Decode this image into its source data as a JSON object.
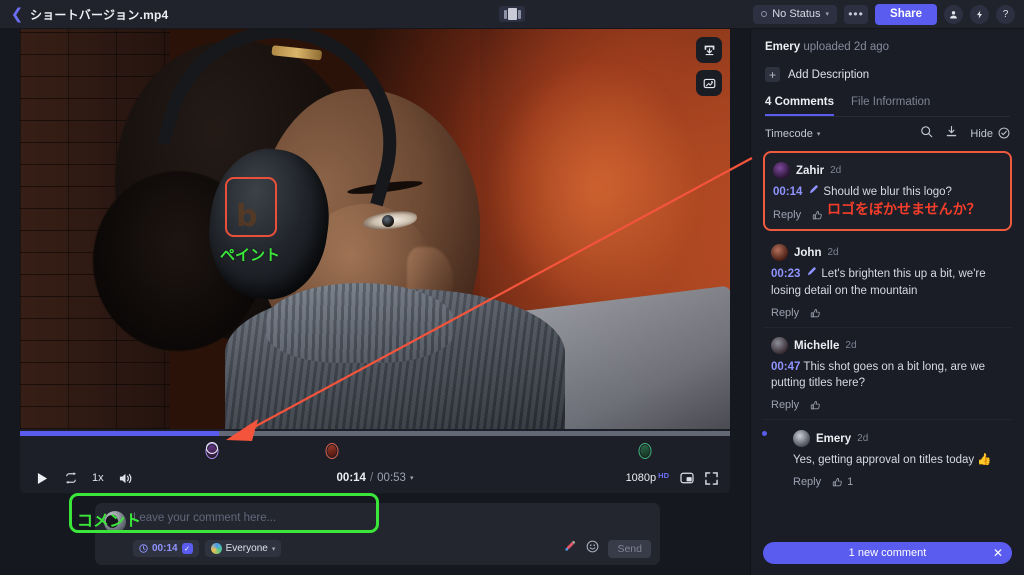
{
  "topbar": {
    "back_icon": "chevron-left-icon",
    "file_title": "ショートバージョン.mp4",
    "compare_icon": "compare-view-icon",
    "status_label": "No Status",
    "status_caret": "▾",
    "more_label": "•••",
    "share_label": "Share",
    "icons": [
      "person-icon",
      "lightning-icon",
      "help-icon"
    ],
    "person_glyph": "👤",
    "lightning_glyph": "⚡",
    "help_glyph": "?"
  },
  "player": {
    "stage_tools": [
      "download-frame-icon",
      "compare-frame-icon"
    ],
    "annotation": {
      "box_color": "#e8503a",
      "label_text": "ペイント",
      "label_color": "#39e639"
    },
    "scrubber": {
      "progress_percent": 28,
      "playhead_percent": 27,
      "markers": [
        {
          "name": "marker-zahir",
          "percent": 27
        },
        {
          "name": "marker-john",
          "percent": 44
        },
        {
          "name": "marker-michelle",
          "percent": 88
        }
      ]
    },
    "controls": {
      "play_icon": "play-icon",
      "loop_icon": "loop-icon",
      "speed_label": "1x",
      "volume_icon": "volume-icon",
      "current_time": "00:14",
      "time_separator": "/",
      "total_time": "00:53",
      "time_caret": "▾",
      "quality_label": "1080p",
      "quality_badge": "HD",
      "pip_icon": "picture-in-picture-icon",
      "fullscreen_icon": "fullscreen-icon"
    }
  },
  "composer": {
    "avatar": "user-avatar",
    "placeholder": "Leave your comment here...",
    "timecode_label": "00:14",
    "timecode_checked": "✓",
    "audience_label": "Everyone",
    "audience_caret": "▾",
    "draw_icon": "draw-icon",
    "emoji_icon": "emoji-icon",
    "send_label": "Send",
    "annotation_label": "コメント",
    "annotation_color": "#39e639"
  },
  "sidebar": {
    "uploader_name": "Emery",
    "uploaded_text": "uploaded 2d ago",
    "add_description_label": "Add Description",
    "add_description_icon": "plus-icon",
    "tabs": [
      {
        "label": "4 Comments",
        "active": true
      },
      {
        "label": "File Information",
        "active": false
      }
    ],
    "toolbar": {
      "sort_label": "Timecode",
      "sort_caret": "▾",
      "search_icon": "search-icon",
      "download_icon": "download-icon",
      "hide_label": "Hide",
      "hide_icon": "check-circle-icon"
    },
    "comments": [
      {
        "name": "Zahir",
        "time": "2d",
        "timecode": "00:14",
        "has_annotation_icon": true,
        "text": "Should we blur this logo?",
        "reply_label": "Reply",
        "like_icon": "thumbs-up-icon",
        "like_count": "",
        "highlighted": true,
        "overlay_text": "ロゴをぼかせませんか？",
        "overlay_color": "#f43d2a"
      },
      {
        "name": "John",
        "time": "2d",
        "timecode": "00:23",
        "has_annotation_icon": true,
        "text": "Let's brighten this up a bit, we're losing detail on the mountain",
        "reply_label": "Reply",
        "like_icon": "thumbs-up-icon",
        "like_count": "",
        "highlighted": false
      },
      {
        "name": "Michelle",
        "time": "2d",
        "timecode": "00:47",
        "has_annotation_icon": false,
        "text": "This shot goes on a bit long, are we putting titles here?",
        "reply_label": "Reply",
        "like_icon": "thumbs-up-icon",
        "like_count": "",
        "highlighted": false
      }
    ],
    "reply": {
      "name": "Emery",
      "time": "2d",
      "text": "Yes, getting approval on titles today 👍",
      "reply_label": "Reply",
      "like_icon": "thumbs-up-icon",
      "like_count": "1",
      "unread": true
    },
    "new_comment_banner": {
      "label": "1 new comment",
      "close_glyph": "✕"
    }
  },
  "colors": {
    "accent": "#5a5cf0",
    "highlight_red": "#ee5a3e",
    "annotation_green": "#39e639",
    "arrow_red": "#f4543c"
  }
}
